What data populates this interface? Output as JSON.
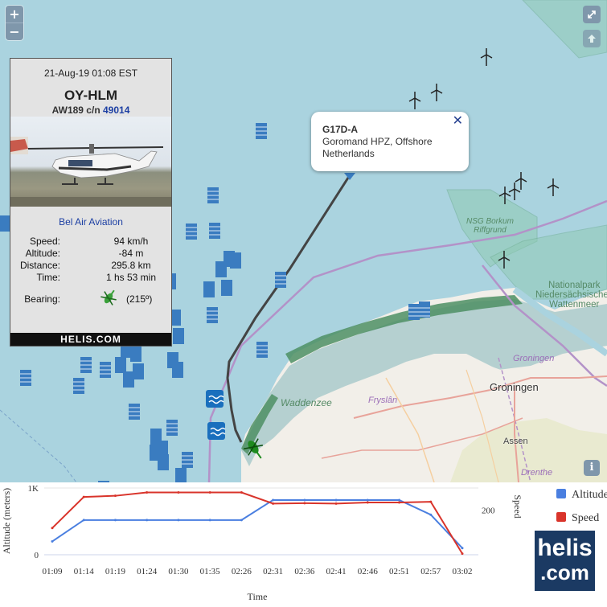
{
  "map": {
    "zoom_in": "+",
    "zoom_out": "−",
    "fullscreen_icon": "expand-icon",
    "locate_icon": "up-arrow-icon",
    "info_button": "i",
    "labels": {
      "nsg": "NSG Borkum\nRiffgrund",
      "park": "Nationalpark\nNiedersächsisches\nWattenmeer",
      "waddenzee": "Waddenzee",
      "fryslan": "Fryslân",
      "groningen_prov": "Groningen",
      "drenthe": "Drenthe",
      "groningen_city": "Groningen",
      "assen": "Assen"
    }
  },
  "popup": {
    "title": "G17D-A",
    "line1": "Goromand HPZ, Offshore",
    "line2": "Netherlands",
    "close": "✕"
  },
  "card": {
    "datetime": "21-Aug-19 01:08 EST",
    "registration": "OY-HLM",
    "type_prefix": "AW189 c/n",
    "cn": "49014",
    "operator": "Bel Air Aviation",
    "rows": [
      {
        "label": "Speed:",
        "value": "94 km/h"
      },
      {
        "label": "Altitude:",
        "value": "-84 m"
      },
      {
        "label": "Distance:",
        "value": "295.8 km"
      },
      {
        "label": "Time:",
        "value": "1 hs 53 min"
      }
    ],
    "bearing_label": "Bearing:",
    "bearing_value": "(215º)",
    "footer": "HELIS.COM"
  },
  "colors": {
    "altitude": "#4a7fe0",
    "speed": "#d9342b",
    "track": "#444444",
    "logo": "#1b3a63"
  },
  "chart_data": {
    "type": "line",
    "xlabel": "Time",
    "ylabel_left": "Altitude (meters)",
    "ylabel_right": "Speed",
    "left_ticks": [
      "0",
      "1K"
    ],
    "right_ticks": [
      "200"
    ],
    "categories": [
      "01:09",
      "01:14",
      "01:19",
      "01:24",
      "01:30",
      "01:35",
      "02:26",
      "02:31",
      "02:36",
      "02:41",
      "02:46",
      "02:51",
      "02:57",
      "03:02"
    ],
    "legend": [
      "Altitude",
      "Speed"
    ],
    "series": [
      {
        "name": "Altitude",
        "axis": "left",
        "values": [
          200,
          520,
          520,
          520,
          520,
          520,
          520,
          820,
          820,
          820,
          820,
          820,
          600,
          100
        ]
      },
      {
        "name": "Speed",
        "axis": "right",
        "values": [
          120,
          260,
          265,
          280,
          280,
          280,
          280,
          230,
          232,
          230,
          235,
          235,
          238,
          5
        ]
      }
    ]
  },
  "logo": {
    "line1": "helis",
    "line2": ".com"
  }
}
